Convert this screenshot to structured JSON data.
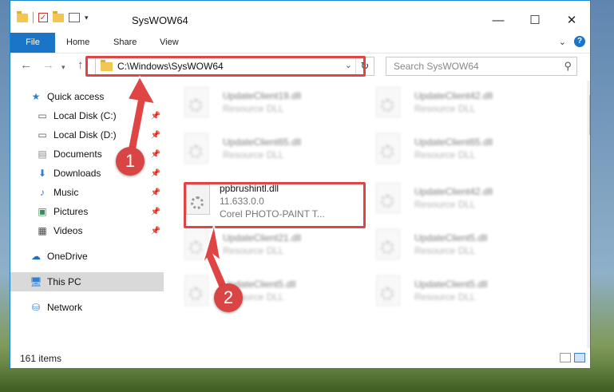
{
  "window": {
    "title": "SysWOW64",
    "controls": {
      "minimize": "—",
      "maximize": "☐",
      "close": "✕"
    }
  },
  "ribbon": {
    "tabs": [
      "File",
      "Home",
      "Share",
      "View"
    ]
  },
  "address": {
    "path": "C:\\Windows\\SysWOW64",
    "search_placeholder": "Search SysWOW64"
  },
  "sidebar": {
    "items": [
      {
        "label": "Quick access",
        "icon": "star-icon"
      },
      {
        "label": "Local Disk (C:)",
        "icon": "drive-icon",
        "pinned": true
      },
      {
        "label": "Local Disk (D:)",
        "icon": "drive-icon",
        "pinned": true
      },
      {
        "label": "Documents",
        "icon": "document-icon",
        "pinned": true
      },
      {
        "label": "Downloads",
        "icon": "download-icon",
        "pinned": true
      },
      {
        "label": "Music",
        "icon": "music-icon",
        "pinned": true
      },
      {
        "label": "Pictures",
        "icon": "picture-icon",
        "pinned": true
      },
      {
        "label": "Videos",
        "icon": "video-icon",
        "pinned": true
      },
      {
        "label": "OneDrive",
        "icon": "cloud-icon"
      },
      {
        "label": "This PC",
        "icon": "computer-icon",
        "selected": true
      },
      {
        "label": "Network",
        "icon": "network-icon"
      }
    ]
  },
  "files": {
    "col1": [
      {
        "name": "UpdateClient19.dll",
        "type": "Resource DLL"
      },
      {
        "name": "UpdateClient65.dll",
        "type": "Resource DLL"
      },
      {
        "name": "ppbrushintl.dll",
        "version": "11.633.0.0",
        "description": "Corel PHOTO-PAINT T..."
      },
      {
        "name": "UpdateClient21.dll",
        "type": "Resource DLL"
      },
      {
        "name": "UpdateClient5.dll",
        "type": "Resource DLL"
      }
    ],
    "col2": [
      {
        "name": "UpdateClient42.dll",
        "type": "Resource DLL"
      },
      {
        "name": "UpdateClient65.dll",
        "type": "Resource DLL"
      },
      {
        "name": "UpdateClient42.dll",
        "type": "Resource DLL"
      },
      {
        "name": "UpdateClient5.dll",
        "type": "Resource DLL"
      },
      {
        "name": "UpdateClient5.dll",
        "type": "Resource DLL"
      }
    ]
  },
  "status": {
    "count": "161 items"
  },
  "annotations": {
    "step1": "1",
    "step2": "2",
    "color": "#d94545"
  }
}
